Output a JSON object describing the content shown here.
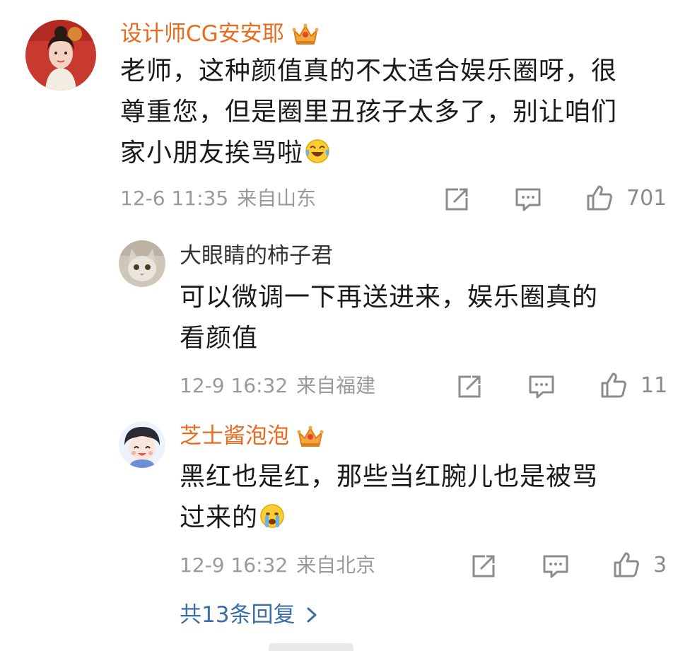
{
  "comment": {
    "username": "设计师CG安安耶",
    "text_lines": [
      "老师，这种颜值真的不太适合娱乐圈呀，很",
      "尊重您，但是圈里丑孩子太多了，别让咱们",
      "家小朋友挨骂啦"
    ],
    "time": "12-6 11:35",
    "location": "来自山东",
    "likes": "701"
  },
  "replies": [
    {
      "username": "大眼睛的柿子君",
      "text_lines": [
        "可以微调一下再送进来，娱乐圈真的",
        "看颜值"
      ],
      "time": "12-9 16:32",
      "location": "来自福建",
      "likes": "11"
    },
    {
      "username": "芝士酱泡泡",
      "text_lines": [
        "黑红也是红，那些当红腕儿也是被骂",
        "过来的"
      ],
      "time": "12-9 16:32",
      "location": "来自北京",
      "likes": "3"
    }
  ],
  "more_replies_label": "共13条回复",
  "icons": {
    "share": "share-icon",
    "comment": "comment-icon",
    "like": "like-icon",
    "vip": "crown-icon",
    "chevron": "chevron-right-icon"
  },
  "colors": {
    "vip_name": "#e86b1e",
    "link": "#3a6ea5",
    "meta": "#9a9a9a"
  }
}
